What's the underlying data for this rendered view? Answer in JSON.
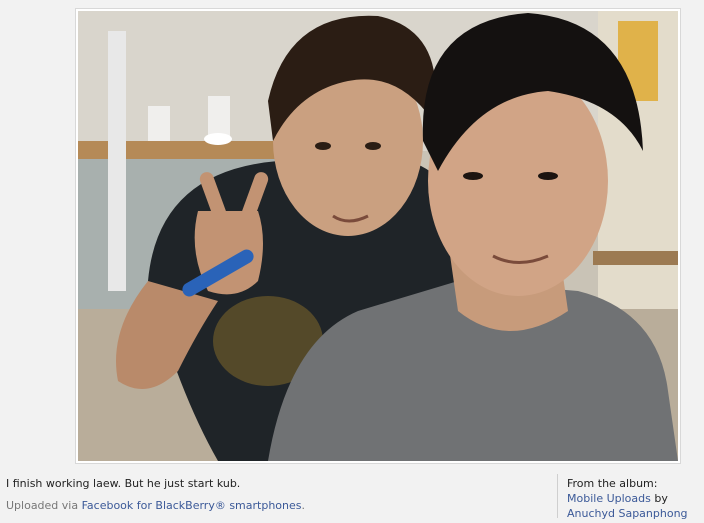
{
  "photo": {
    "alt": "Two young men taking a selfie in a cafe; one making a peace sign"
  },
  "caption": "I finish working laew. But he just start kub.",
  "upload": {
    "prefix": "Uploaded via ",
    "link": "Facebook for BlackBerry® smartphones",
    "suffix": "."
  },
  "album": {
    "label": "From the album:",
    "name": "Mobile Uploads",
    "by": " by ",
    "owner": "Anuchyd Sapanphong"
  },
  "colors": {
    "link": "#3b5998",
    "page_bg": "#f2f2f2"
  }
}
